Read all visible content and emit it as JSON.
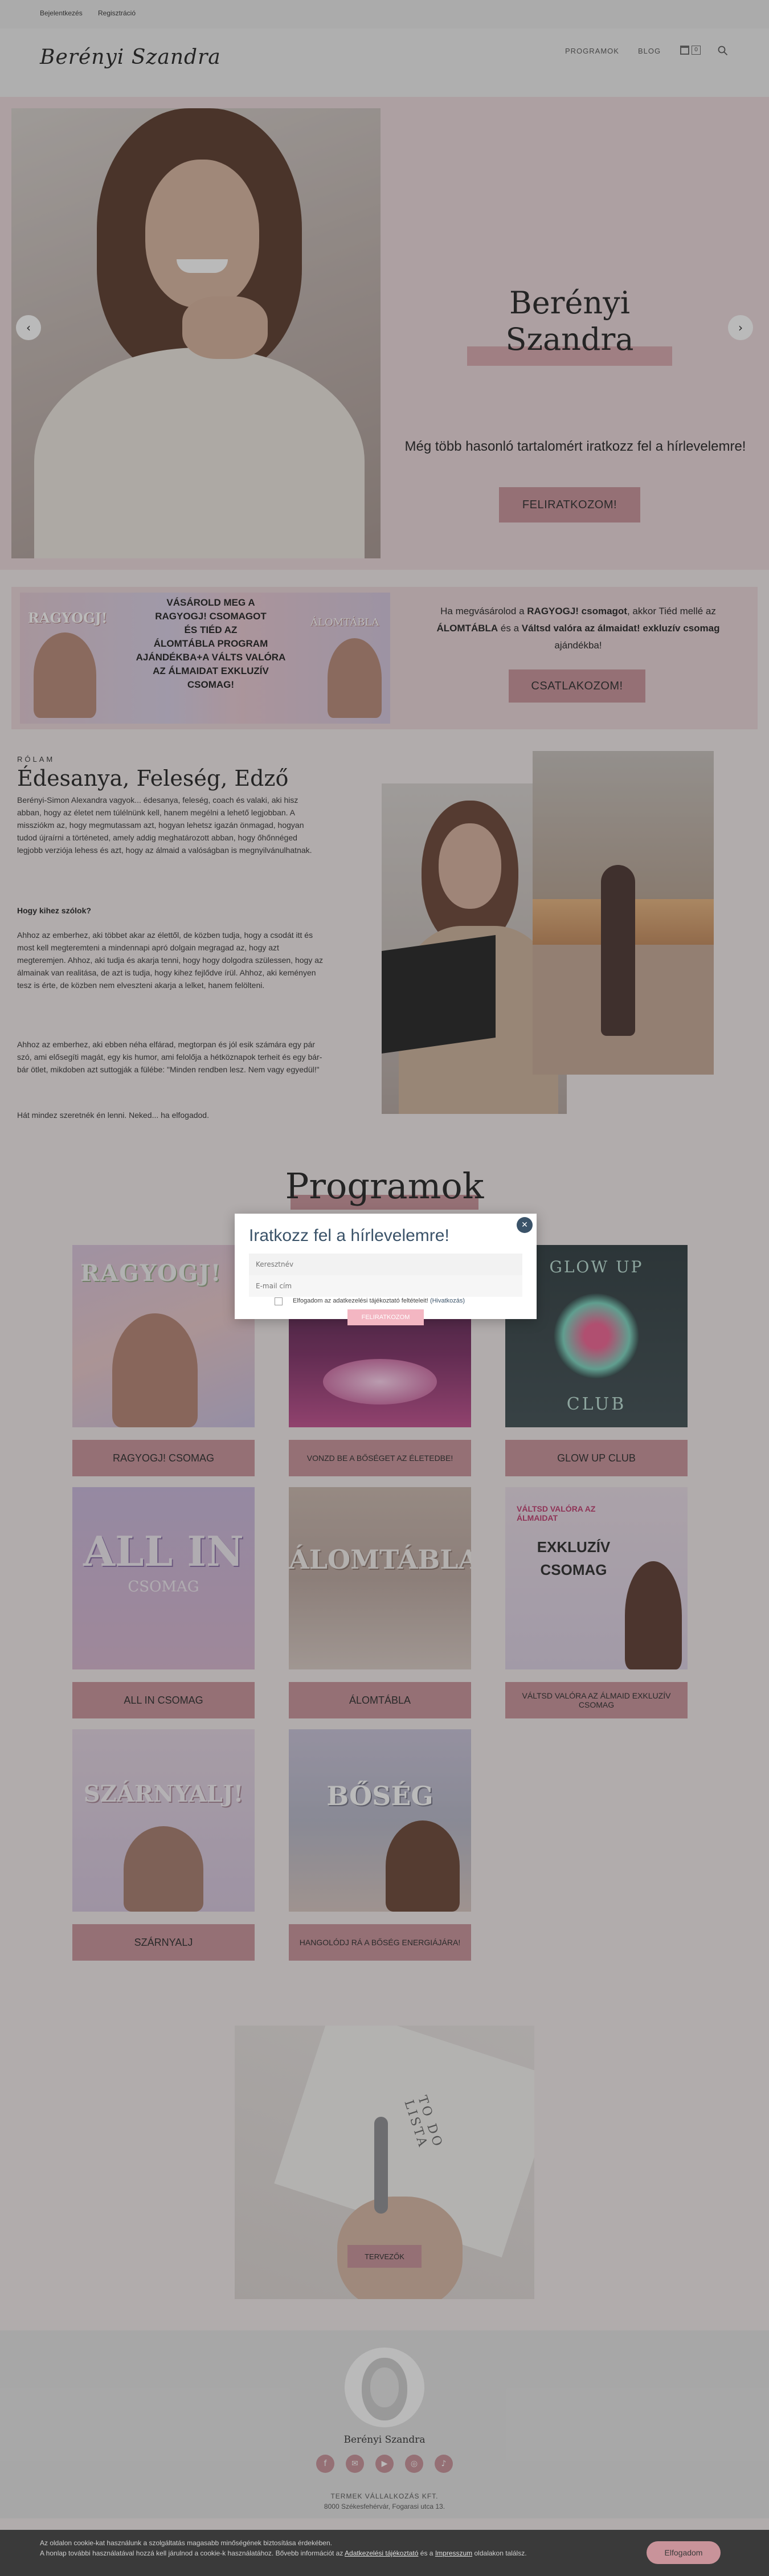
{
  "topbar": {
    "link_1": "Bejelentkezés",
    "link_2": "Regisztráció"
  },
  "header": {
    "logo": "Berényi Szandra",
    "nav": [
      "PROGRAMOK",
      "BLOG"
    ],
    "cart_count": "0"
  },
  "hero": {
    "title_line_1": "Berényi",
    "title_line_2": "Szandra",
    "subtitle": "Még több hasonló tartalomért iratkozz fel a hírlevelemre!",
    "cta": "FELIRATKOZOM!"
  },
  "promo": {
    "banner_brand": "RAGYOGJ!",
    "banner_brand_2": "ÁLOMTÁBLA",
    "banner_lines": [
      "VÁSÁROLD MEG A",
      "RAGYOGJ! CSOMAGOT",
      "ÉS TIÉD AZ",
      "ÁLOMTÁBLA PROGRAM",
      "AJÁNDÉKBA+A VÁLTS VALÓRA",
      "AZ ÁLMAIDAT EXKLUZÍV",
      "CSOMAG!"
    ],
    "text_1": "Ha megvásárolod a",
    "text_bold_1": "RAGYOGJ! csomagot",
    "text_2": ", akkor Tiéd mellé az",
    "text_bold_2": "ÁLOMTÁBLA",
    "text_3": "és a",
    "text_bold_3": "Váltsd valóra az álmaidat! exkluzív csomag",
    "text_4": "ajándékba!",
    "cta": "CSATLAKOZOM!"
  },
  "about": {
    "eyebrow": "RÓLAM",
    "title": "Édesanya, Feleség, Edző",
    "p1": "Berényi-Simon Alexandra vagyok... édesanya, feleség, coach és valaki, aki hisz abban, hogy az életet nem túlélnünk kell, hanem megélni a lehető legjobban. A missziókm az, hogy megmutassam azt, hogyan lehetsz igazán önmagad, hogyan tudod újraírni a történeted, amely addig meghatározott abban, hogy őhőnnéged legjobb verziója lehess és azt, hogy az álmaid a valóságban is megnyilvánulhatnak.",
    "q": "Hogy kihez szólok?",
    "p2": "Ahhoz az emberhez, aki többet akar az élettől, de közben tudja, hogy a csodát itt és most kell megteremteni a mindennapi apró dolgain megragad az, hogy azt megteremjen. Ahhoz, aki tudja és akarja tenni, hogy hogy dolgodra szülessen, hogy az álmainak van realitása, de azt is tudja, hogy kihez fejlődve írül. Ahhoz, aki keményen tesz is érte, de közben nem elveszteni akarja a lelket, hanem felölteni.",
    "p3": "Ahhoz az emberhez, aki ebben néha elfárad, megtorpan és jól esik számára egy pár szó, ami elősegíti magát, egy kis humor, ami felolőja a hétköznapok terheit és egy bár-bár ötlet, mikdoben azt suttogják a fülébe: \"Minden rendben lesz. Nem vagy egyedül!\"",
    "p4": "Hát mindez szeretnék én lenni. Neked... ha elfogadod."
  },
  "programs": {
    "title": "Programok",
    "cards": [
      {
        "label": "RAGYOGJ! CSOMAG",
        "art": "RAGYOGJ!"
      },
      {
        "label": "VONZD BE A BŐSÉGET AZ ÉLETEDBE!",
        "art": ""
      },
      {
        "label": "GLOW UP CLUB",
        "art_top": "GLOW UP",
        "art_bottom": "CLUB"
      },
      {
        "label": "ALL IN CSOMAG",
        "art": "ALL IN",
        "art_sub": "CSOMAG"
      },
      {
        "label": "ÁLOMTÁBLA",
        "art": "ÁLOMTÁBLA"
      },
      {
        "label": "VÁLTSD VALÓRA AZ ÁLMAID EXKLUZÍV CSOMAG",
        "art_top": "VÁLTSD VALÓRA AZ ÁLMAIDAT",
        "art_mid": "EXKLUZÍV",
        "art_bottom": "CSOMAG"
      },
      {
        "label": "SZÁRNYALJ",
        "art": "SZÁRNYALJ!"
      },
      {
        "label": "HANGOLÓDJ RÁ A BŐSÉG ENERGIÁJÁRA!",
        "art": "BŐSÉG"
      }
    ]
  },
  "planner": {
    "art_text": "TO DO LISTA",
    "button": "TERVEZŐK"
  },
  "footer": {
    "name": "Berényi Szandra",
    "social": [
      "f",
      "✉",
      "▶",
      "◎",
      "♪"
    ],
    "company": "TERMEK VÁLLALKOZÁS KFT.",
    "address": "8000 Székesfehérvár, Fogarasi utca 13."
  },
  "modal": {
    "title": "Iratkozz fel a hírlevelemre!",
    "name_placeholder": "Keresztnév",
    "email_placeholder": "E-mail cím",
    "consent": "Elfogadom az adatkezelési tájékoztató feltételeit!",
    "consent_link": "(Hivatkozás)",
    "submit": "FELIRATKOZOM"
  },
  "cookie": {
    "text_1": "Az oldalon cookie-kat használunk a szolgáltatás magasabb minőségének biztosítása érdekében.",
    "text_2": "A honlap további használatával hozzá kell járulnod a cookie-k használatához. Bővebb információt az",
    "link_1": "Adatkezelési tájékoztató",
    "text_3": "és a",
    "link_2": "Impresszum",
    "text_4": "oldalakon találsz.",
    "button": "Elfogadom"
  },
  "colors": {
    "accent": "#c9939a",
    "hero_bg": "#ecd9dc",
    "modal_close": "#3b5369",
    "cookie_bg": "#3a3a3a"
  }
}
